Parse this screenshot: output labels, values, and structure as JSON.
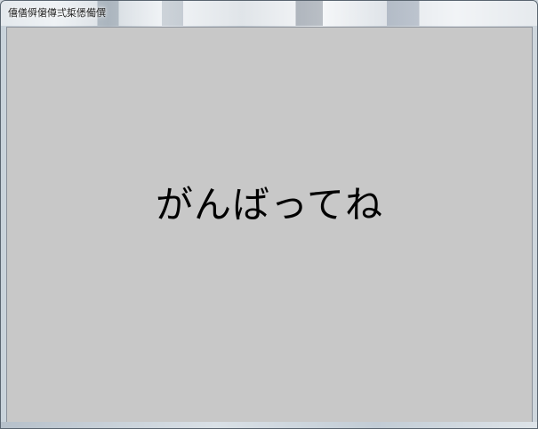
{
  "window": {
    "title": "僖僐僢僒僔弍梊僁僃僎"
  },
  "content": {
    "message": "がんばってね",
    "background_color": "#c8c8c8",
    "text_color": "#000000"
  }
}
